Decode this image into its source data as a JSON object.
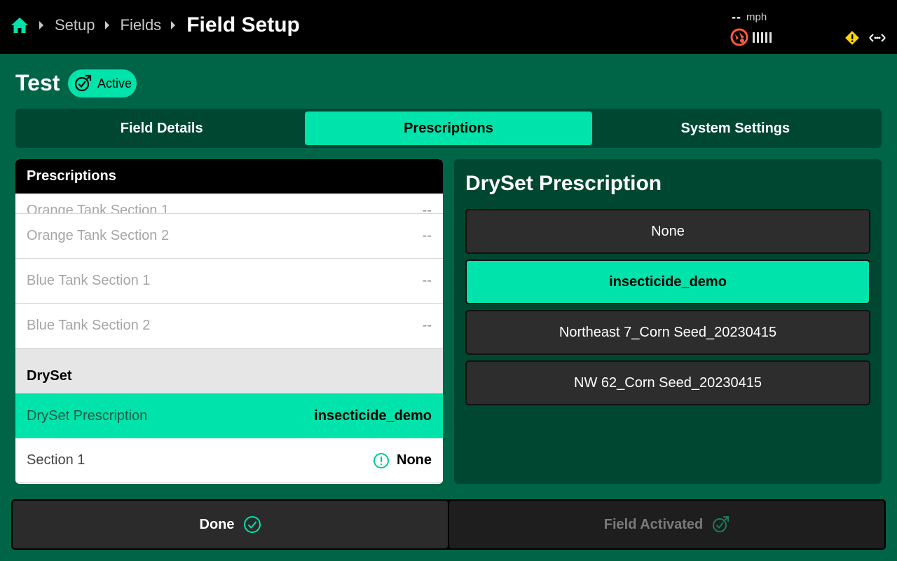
{
  "breadcrumb": {
    "items": [
      "Setup",
      "Fields"
    ],
    "title": "Field Setup"
  },
  "status": {
    "speed_value": "--",
    "speed_unit": "mph"
  },
  "field": {
    "name": "Test",
    "badge": "Active"
  },
  "tabs": [
    {
      "label": "Field Details",
      "selected": false
    },
    {
      "label": "Prescriptions",
      "selected": true
    },
    {
      "label": "System Settings",
      "selected": false
    }
  ],
  "left_panel": {
    "title": "Prescriptions",
    "rows": [
      {
        "label": "Orange Tank Section 1",
        "value": "--"
      },
      {
        "label": "Orange Tank Section 2",
        "value": "--"
      },
      {
        "label": "Blue Tank Section 1",
        "value": "--"
      },
      {
        "label": "Blue Tank Section 2",
        "value": "--"
      }
    ],
    "group": "DrySet",
    "group_rows": [
      {
        "label": "DrySet Prescription",
        "value": "insecticide_demo"
      },
      {
        "label": "Section 1",
        "value": "None"
      }
    ]
  },
  "right_panel": {
    "title": "DrySet Prescription",
    "options": [
      {
        "label": "None",
        "selected": false
      },
      {
        "label": "insecticide_demo",
        "selected": true
      },
      {
        "label": "Northeast 7_Corn Seed_20230415",
        "selected": false
      },
      {
        "label": "NW 62_Corn Seed_20230415",
        "selected": false
      }
    ]
  },
  "footer": {
    "done": "Done",
    "activated": "Field Activated"
  },
  "colors": {
    "accent": "#00e3ab",
    "background": "#006446",
    "panel": "#004731",
    "warning": "#ffd600",
    "gps_alert": "#ff5a3c"
  }
}
